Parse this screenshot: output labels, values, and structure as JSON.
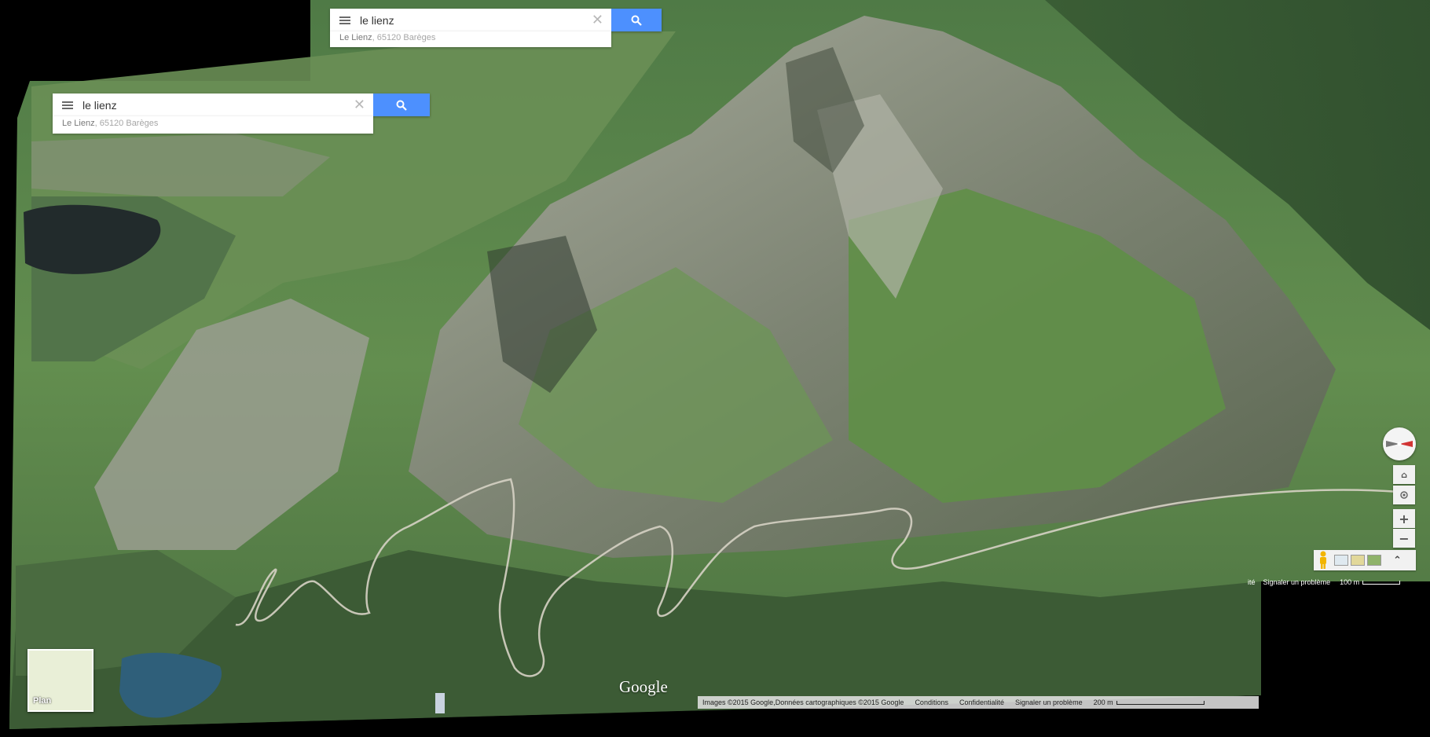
{
  "search_top": {
    "query": "le lienz",
    "suggestion_place": "Le Lienz",
    "suggestion_detail": ", 65120 Barèges"
  },
  "search_main": {
    "query": "le lienz",
    "suggestion_place": "Le Lienz",
    "suggestion_detail": ", 65120 Barèges"
  },
  "map": {
    "logo": "Google",
    "base_layer_button": "Plan",
    "attribution": "Images ©2015 Google,Données cartographiques ©2015 Google",
    "terms_link": "Conditions",
    "privacy_link": "Confidentialité",
    "report_link": "Signaler un problème",
    "scale_label": "200 m",
    "inner_attr_prefix": "ité",
    "inner_report_link": "Signaler un problème",
    "inner_scale_label": "100 m",
    "zoom_in_symbol": "+",
    "zoom_out_symbol": "−",
    "expand_symbol": "⌃"
  },
  "icons": {
    "menu": "hamburger-menu-icon",
    "clear": "close-icon",
    "search": "search-icon",
    "compass": "compass-icon",
    "pegman": "pegman-icon",
    "tilt": "tilt-icon",
    "location": "my-location-icon"
  },
  "colors": {
    "search_button": "#4d90fe",
    "grass": "#5f8a4c",
    "rock": "#8f968a",
    "lake": "#2f5f7a",
    "compass_red": "#d23434"
  }
}
